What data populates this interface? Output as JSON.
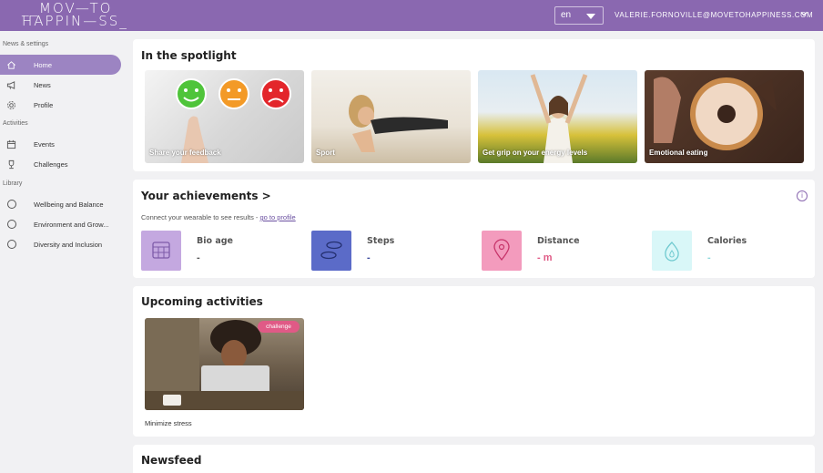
{
  "header": {
    "logo_line1": "__MOV—TO",
    "logo_line2": "HAPPIN—SS_",
    "language": "en",
    "user_email": "VALERIE.FORNOVILLE@MOVETOHAPPINESS.COM"
  },
  "sidebar": {
    "sections": [
      {
        "label": "News & settings",
        "items": [
          {
            "label": "Home",
            "icon": "home-icon",
            "active": true
          },
          {
            "label": "News",
            "icon": "megaphone-icon"
          },
          {
            "label": "Profile",
            "icon": "gear-icon"
          }
        ]
      },
      {
        "label": "Activities",
        "items": [
          {
            "label": "Events",
            "icon": "calendar-icon"
          },
          {
            "label": "Challenges",
            "icon": "trophy-icon"
          }
        ]
      },
      {
        "label": "Library",
        "items": [
          {
            "label": "Wellbeing and Balance",
            "icon": "circle-icon"
          },
          {
            "label": "Environment and Grow...",
            "icon": "circle-icon"
          },
          {
            "label": "Diversity and Inclusion",
            "icon": "circle-icon"
          }
        ]
      }
    ]
  },
  "spotlight": {
    "title": "In the spotlight",
    "items": [
      {
        "label": "Share your feedback"
      },
      {
        "label": "Sport"
      },
      {
        "label": "Get grip on your energy levels"
      },
      {
        "label": "Emotional eating"
      }
    ]
  },
  "achievements": {
    "title": "Your achievements >",
    "subtitle": "Connect your wearable to see results - ",
    "link": "go to profile",
    "metrics": [
      {
        "label": "Bio age",
        "value": "-",
        "color": "#c4a8e0",
        "value_color": "#555555",
        "icon": "calendar-grid-icon"
      },
      {
        "label": "Steps",
        "value": "-",
        "color": "#5b6bc8",
        "value_color": "#3b4a9c",
        "icon": "footprints-icon"
      },
      {
        "label": "Distance",
        "value": "- m",
        "color": "#f39bbd",
        "value_color": "#e05a86",
        "icon": "location-pin-icon"
      },
      {
        "label": "Calories",
        "value": "-",
        "color": "#d9f7f8",
        "value_color": "#8ed8dc",
        "icon": "flame-icon"
      }
    ]
  },
  "upcoming": {
    "title": "Upcoming activities",
    "badge": "challenge",
    "caption": "Minimize stress"
  },
  "newsfeed": {
    "title": "Newsfeed"
  }
}
